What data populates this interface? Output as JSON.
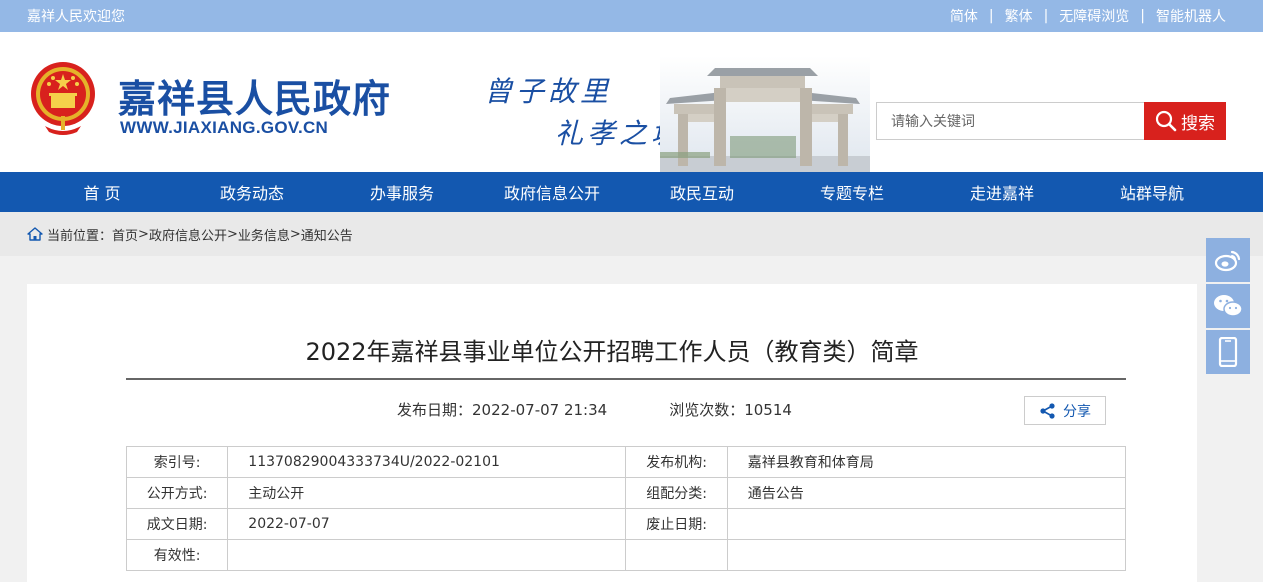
{
  "topbar": {
    "welcome": "嘉祥人民欢迎您",
    "links": [
      "简体",
      "繁体",
      "无障碍浏览",
      "智能机器人"
    ],
    "separator": "|"
  },
  "header": {
    "site_title": "嘉祥县人民政府",
    "site_url": "WWW.JIAXIANG.GOV.CN",
    "slogan_line1": "曾子故里",
    "slogan_line2": "礼孝之城",
    "search_placeholder": "请输入关键词",
    "search_button": "搜索"
  },
  "nav": {
    "items": [
      "首 页",
      "政务动态",
      "办事服务",
      "政府信息公开",
      "政民互动",
      "专题专栏",
      "走进嘉祥",
      "站群导航"
    ]
  },
  "breadcrumb": {
    "prefix": "当前位置：",
    "items": [
      "首页",
      "政府信息公开",
      "业务信息",
      "通知公告"
    ],
    "separator": ">"
  },
  "article": {
    "title": "2022年嘉祥县事业单位公开招聘工作人员（教育类）简章",
    "publish_label": "发布日期：",
    "publish_date": "2022-07-07 21:34",
    "views_label": "浏览次数：",
    "views": "10514",
    "share_label": "分享"
  },
  "info_table": {
    "rows": [
      {
        "l1": "索引号:",
        "v1": "11370829004333734U/2022-02101",
        "l2": "发布机构:",
        "v2": "嘉祥县教育和体育局"
      },
      {
        "l1": "公开方式:",
        "v1": "主动公开",
        "l2": "组配分类:",
        "v2": "通告公告"
      },
      {
        "l1": "成文日期:",
        "v1": "2022-07-07",
        "l2": "废止日期:",
        "v2": ""
      },
      {
        "l1": "有效性:",
        "v1": "",
        "l2": "",
        "v2": ""
      }
    ]
  },
  "side_icons": [
    "weibo-icon",
    "wechat-icon",
    "mobile-icon"
  ],
  "colors": {
    "topbar": "#94b8e6",
    "brand_blue": "#1a4fa3",
    "nav": "#1358b0",
    "search_button": "#d8211d",
    "side_button": "#8db0e0"
  }
}
